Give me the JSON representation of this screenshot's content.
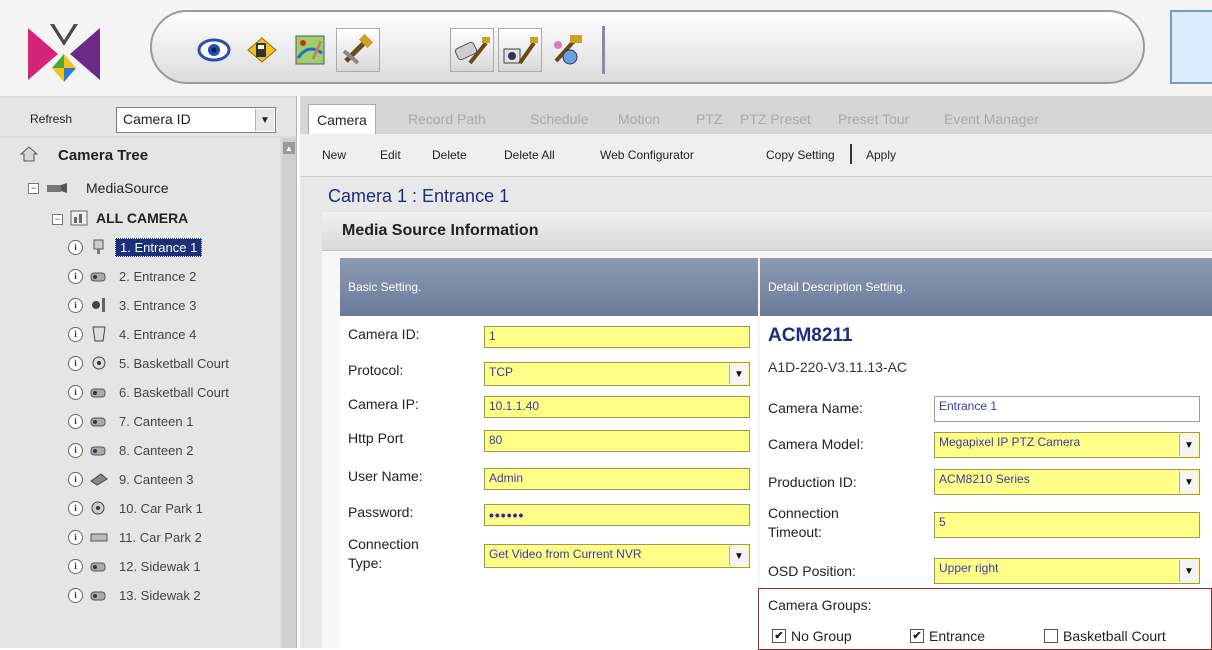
{
  "toolbar": {
    "buttons": [
      {
        "name": "view-icon"
      },
      {
        "name": "playback-icon"
      },
      {
        "name": "emap-icon"
      },
      {
        "name": "setting-tools-icon"
      },
      {
        "name": "camera-tools-icon"
      },
      {
        "name": "device-tools-icon"
      },
      {
        "name": "network-tools-icon"
      }
    ]
  },
  "left_panel": {
    "refresh_label": "Refresh",
    "sort_select": "Camera ID",
    "tree_title": "Camera Tree",
    "media_source": "MediaSource",
    "all_camera": "ALL CAMERA",
    "cameras": [
      {
        "label": "1. Entrance 1",
        "selected": true
      },
      {
        "label": "2. Entrance 2"
      },
      {
        "label": "3. Entrance 3"
      },
      {
        "label": "4. Entrance 4"
      },
      {
        "label": "5. Basketball Court"
      },
      {
        "label": "6. Basketball Court"
      },
      {
        "label": "7. Canteen 1"
      },
      {
        "label": "8. Canteen 2"
      },
      {
        "label": "9. Canteen 3"
      },
      {
        "label": "10. Car Park 1"
      },
      {
        "label": "11. Car Park 2"
      },
      {
        "label": "12. Sidewak 1"
      },
      {
        "label": "13. Sidewak 2"
      }
    ]
  },
  "tabs": [
    "Camera",
    "Record Path",
    "Schedule",
    "Motion",
    "PTZ",
    "PTZ Preset",
    "Preset Tour",
    "Event Manager"
  ],
  "actions": {
    "new": "New",
    "edit": "Edit",
    "delete": "Delete",
    "delete_all": "Delete All",
    "web_configurator": "Web Configurator",
    "copy_setting": "Copy Setting",
    "apply": "Apply"
  },
  "main": {
    "heading": "Camera 1 : Entrance 1",
    "section_title": "Media Source Information",
    "basic_header": "Basic Setting.",
    "detail_header": "Detail Description Setting."
  },
  "basic": {
    "camera_id_label": "Camera ID:",
    "camera_id": "1",
    "protocol_label": "Protocol:",
    "protocol": "TCP",
    "camera_ip_label": "Camera IP:",
    "camera_ip": "10.1.1.40",
    "http_port_label": "Http Port",
    "http_port": "80",
    "user_name_label": "User Name:",
    "user_name": "Admin",
    "password_label": "Password:",
    "password": "••••••",
    "connection_type_label_1": "Connection",
    "connection_type_label_2": "Type:",
    "connection_type": "Get Video from Current NVR"
  },
  "detail": {
    "model": "ACM8211",
    "firmware": "A1D-220-V3.11.13-AC",
    "camera_name_label": "Camera Name:",
    "camera_name": "Entrance 1",
    "camera_model_label": "Camera Model:",
    "camera_model": "Megapixel IP PTZ Camera",
    "production_id_label": "Production ID:",
    "production_id": "ACM8210 Series",
    "connection_timeout_label_1": "Connection",
    "connection_timeout_label_2": "Timeout:",
    "connection_timeout": "5",
    "osd_position_label": "OSD Position:",
    "osd_position": "Upper right",
    "groups_label": "Camera Groups:",
    "groups": [
      {
        "label": "No Group",
        "checked": true
      },
      {
        "label": "Entrance",
        "checked": true
      },
      {
        "label": "Basketball Court",
        "checked": false
      }
    ]
  }
}
